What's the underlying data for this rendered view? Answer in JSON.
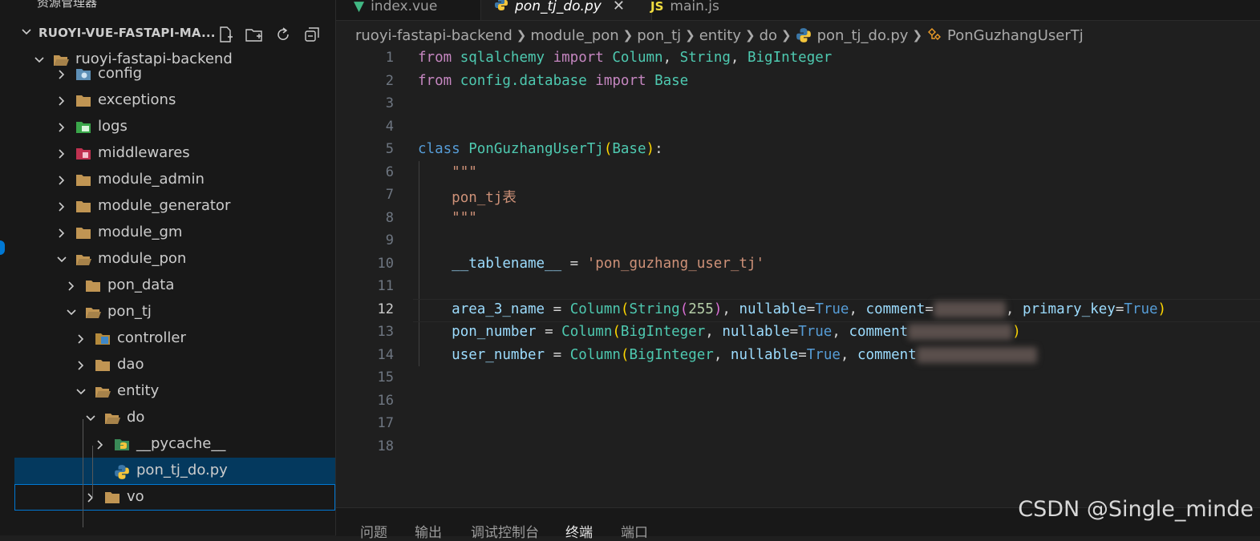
{
  "sidebar": {
    "title": "资源管理器",
    "more": "···",
    "project_name": "RUOYI-VUE-FASTAPI-MA...",
    "actions": [
      "new-file-icon",
      "new-folder-icon",
      "refresh-icon",
      "collapse-all-icon"
    ],
    "tree": [
      {
        "label": "ruoyi-fastapi-backend",
        "depth": 0,
        "expanded": true,
        "icon": "folder-open-icon"
      },
      {
        "label": "config",
        "depth": 1,
        "expanded": false,
        "icon": "config-folder-icon"
      },
      {
        "label": "exceptions",
        "depth": 1,
        "expanded": false,
        "icon": "folder-icon"
      },
      {
        "label": "logs",
        "depth": 1,
        "expanded": false,
        "icon": "logs-folder-icon"
      },
      {
        "label": "middlewares",
        "depth": 1,
        "expanded": false,
        "icon": "middleware-folder-icon"
      },
      {
        "label": "module_admin",
        "depth": 1,
        "expanded": false,
        "icon": "folder-icon"
      },
      {
        "label": "module_generator",
        "depth": 1,
        "expanded": false,
        "icon": "folder-icon"
      },
      {
        "label": "module_gm",
        "depth": 1,
        "expanded": false,
        "icon": "folder-icon"
      },
      {
        "label": "module_pon",
        "depth": 1,
        "expanded": true,
        "icon": "folder-open-icon"
      },
      {
        "label": "pon_data",
        "depth": 2,
        "expanded": false,
        "icon": "folder-icon"
      },
      {
        "label": "pon_tj",
        "depth": 2,
        "expanded": true,
        "icon": "folder-open-icon"
      },
      {
        "label": "controller",
        "depth": 3,
        "expanded": false,
        "icon": "controller-folder-icon"
      },
      {
        "label": "dao",
        "depth": 3,
        "expanded": false,
        "icon": "folder-icon"
      },
      {
        "label": "entity",
        "depth": 3,
        "expanded": true,
        "icon": "folder-open-icon"
      },
      {
        "label": "do",
        "depth": 4,
        "expanded": true,
        "icon": "folder-open-icon"
      },
      {
        "label": "__pycache__",
        "depth": 5,
        "expanded": false,
        "icon": "pycache-folder-icon"
      },
      {
        "label": "pon_tj_do.py",
        "depth": 5,
        "file": true,
        "selected": true,
        "icon": "python-file-icon"
      },
      {
        "label": "vo",
        "depth": 4,
        "expanded": false,
        "icon": "folder-icon",
        "focused": true
      }
    ]
  },
  "tabs": [
    {
      "label": "index.vue",
      "icon": "▼",
      "active": false,
      "icon_color": "#41b883"
    },
    {
      "label": "pon_tj_do.py",
      "icon": "py",
      "active": true,
      "close": "✕"
    },
    {
      "label": "main.js",
      "icon": "JS",
      "active": false,
      "icon_color": "#f1dd3f"
    }
  ],
  "breadcrumb": [
    "ruoyi-fastapi-backend",
    "module_pon",
    "pon_tj",
    "entity",
    "do",
    "pon_tj_do.py",
    "PonGuzhangUserTj"
  ],
  "editor": {
    "current_line": 12,
    "line_numbers": [
      "1",
      "2",
      "3",
      "4",
      "5",
      "6",
      "7",
      "8",
      "9",
      "10",
      "11",
      "12",
      "13",
      "14",
      "15",
      "16",
      "17",
      "18"
    ]
  },
  "panel_tabs": [
    "问题",
    "输出",
    "调试控制台",
    "终端",
    "端口"
  ],
  "panel_active": "终端",
  "watermark": "CSDN @Single_minde"
}
